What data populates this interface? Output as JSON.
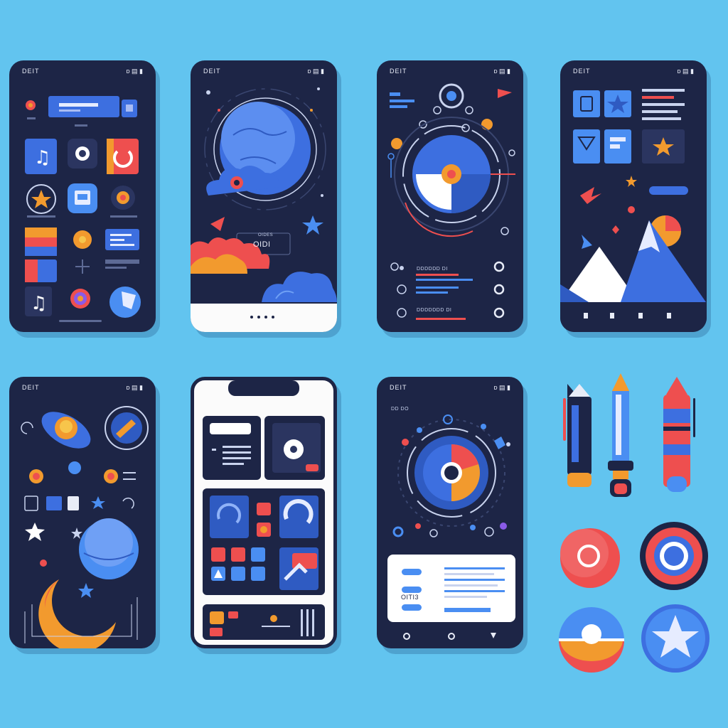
{
  "screens": [
    {
      "status_left": "DEIT",
      "status_right": "ᴅ ▤ ▮",
      "caption_a": "",
      "caption_b": ""
    },
    {
      "status_left": "DEIT",
      "status_right": "ᴅ ▤ ▮",
      "center_line1": "OIDES",
      "center_line2": "OIDI"
    },
    {
      "status_left": "DEIT",
      "status_right": "ᴅ ▤ ▮",
      "row_1": "DDDDDD DI",
      "row_3": "DDDDDDD DI"
    },
    {
      "status_left": "DEIT",
      "status_right": "ᴅ ▤ ▮"
    },
    {
      "status_left": "DEIT",
      "status_right": "ᴅ ▤ ▮"
    },
    {
      "status_left": "",
      "status_right": ""
    },
    {
      "status_left": "DEIT",
      "status_right": "ᴅ ▤ ▮",
      "tag": "DD DO",
      "card_text": "OITI3"
    }
  ],
  "palette": {
    "background": "#62c4ef",
    "phone": "#1d2546",
    "blue": "#3d6fe0",
    "orange": "#f29a2e",
    "red": "#ee4f4f",
    "white": "#ffffff"
  }
}
